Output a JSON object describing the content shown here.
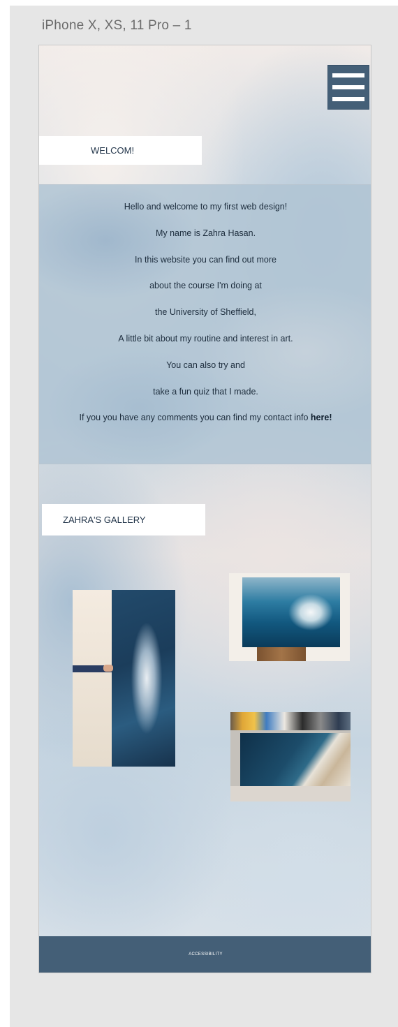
{
  "artboard_title": "iPhone X, XS, 11 Pro – 1",
  "header": {
    "menu_icon": "hamburger-menu-icon",
    "welcome_label": "WELCOM!"
  },
  "intro": {
    "lines": [
      "Hello and welcome to my first web design!",
      "My name is Zahra Hasan.",
      "In this website you can find out more",
      "about the course I'm doing at",
      "the University of Sheffield,",
      "A little bit about my routine and interest in art.",
      "You can also try and",
      "take a fun quiz that I made."
    ],
    "contact_prefix": "If you you have any comments you can find my contact info ",
    "contact_link": "here!"
  },
  "gallery": {
    "title": "ZAHRA'S GALLERY",
    "photos": [
      "whale painting",
      "wave painting",
      "shoreline painting"
    ]
  },
  "footer": {
    "link": "ACCESSIBILITY"
  },
  "colors": {
    "accent": "#445f77",
    "text_dark": "#1f3247",
    "canvas_bg": "#e6e6e6"
  }
}
